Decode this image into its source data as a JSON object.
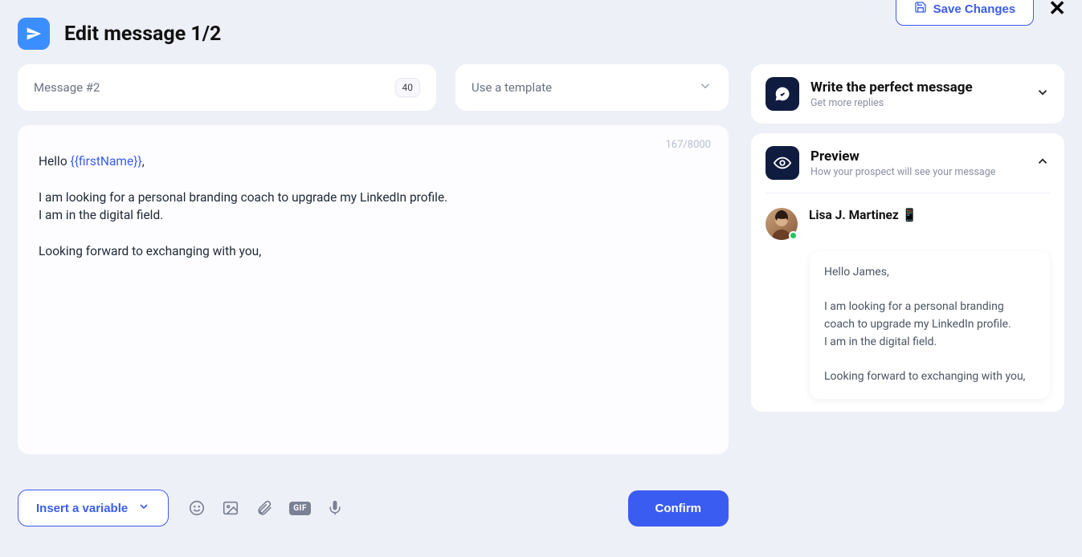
{
  "topbar": {
    "save_label": "Save Changes"
  },
  "header": {
    "title": "Edit message 1/2"
  },
  "message": {
    "label": "Message #2",
    "count": "40"
  },
  "template": {
    "placeholder": "Use a template"
  },
  "editor": {
    "char_count": "167/8000",
    "greeting_prefix": "Hello ",
    "variable": "{{firstName}}",
    "greeting_suffix": ",",
    "body": "I am looking for a personal branding coach to upgrade my LinkedIn profile.\nI am in the digital field.\n\nLooking forward to exchanging with you,"
  },
  "toolbar": {
    "insert_variable": "Insert a variable",
    "gif_label": "GIF",
    "confirm": "Confirm"
  },
  "panels": {
    "perfect": {
      "title": "Write the perfect message",
      "subtitle": "Get more replies"
    },
    "preview": {
      "title": "Preview",
      "subtitle": "How your prospect will see your message",
      "prospect_name": "Lisa J. Martinez",
      "prospect_emoji": "📱",
      "message": "Hello James,\n\nI am looking for a personal branding coach to upgrade my LinkedIn profile.\nI am in the digital field.\n\nLooking forward to exchanging with you,"
    }
  }
}
